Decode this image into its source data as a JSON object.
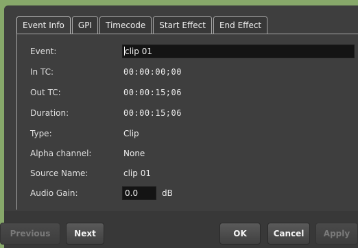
{
  "tabs": [
    {
      "label": "Event Info"
    },
    {
      "label": "GPI"
    },
    {
      "label": "Timecode"
    },
    {
      "label": "Start Effect"
    },
    {
      "label": "End Effect"
    }
  ],
  "fields": {
    "event": {
      "label": "Event:",
      "value": "clip 01"
    },
    "in_tc": {
      "label": "In TC:",
      "value": "00:00:00;00"
    },
    "out_tc": {
      "label": "Out TC:",
      "value": "00:00:15;06"
    },
    "duration": {
      "label": "Duration:",
      "value": "00:00:15;06"
    },
    "type": {
      "label": "Type:",
      "value": "Clip"
    },
    "alpha": {
      "label": "Alpha channel:",
      "value": "None"
    },
    "source": {
      "label": "Source Name:",
      "value": "clip 01"
    },
    "audio_gain": {
      "label": "Audio Gain:",
      "value": "0.0",
      "unit": "dB"
    }
  },
  "buttons": {
    "previous": "Previous",
    "next": "Next",
    "ok": "OK",
    "cancel": "Cancel",
    "apply": "Apply"
  }
}
